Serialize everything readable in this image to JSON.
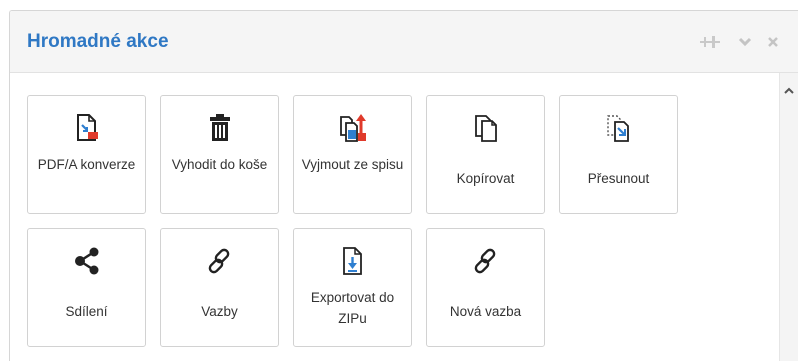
{
  "panel": {
    "title": "Hromadné akce"
  },
  "header_controls": [
    {
      "icon": "pin-icon"
    },
    {
      "icon": "chevron-down-icon"
    },
    {
      "icon": "close-icon"
    }
  ],
  "actions": [
    {
      "label": "PDF/A konverze",
      "icon": "pdf-convert-icon"
    },
    {
      "label": "Vyhodit do koše",
      "icon": "trash-icon"
    },
    {
      "label": "Vyjmout ze spisu",
      "icon": "remove-from-file-icon"
    },
    {
      "label": "Kopírovat",
      "icon": "copy-icon"
    },
    {
      "label": "Přesunout",
      "icon": "move-icon"
    },
    {
      "label": "Sdílení",
      "icon": "share-icon"
    },
    {
      "label": "Vazby",
      "icon": "link-icon"
    },
    {
      "label": "Exportovat do ZIPu",
      "icon": "export-zip-icon"
    },
    {
      "label": "Nová vazba",
      "icon": "new-link-icon"
    }
  ],
  "colors": {
    "title": "#2f78c4",
    "accent_blue": "#2f7fd0",
    "accent_red": "#e03a2b",
    "icon_dark": "#222222"
  }
}
